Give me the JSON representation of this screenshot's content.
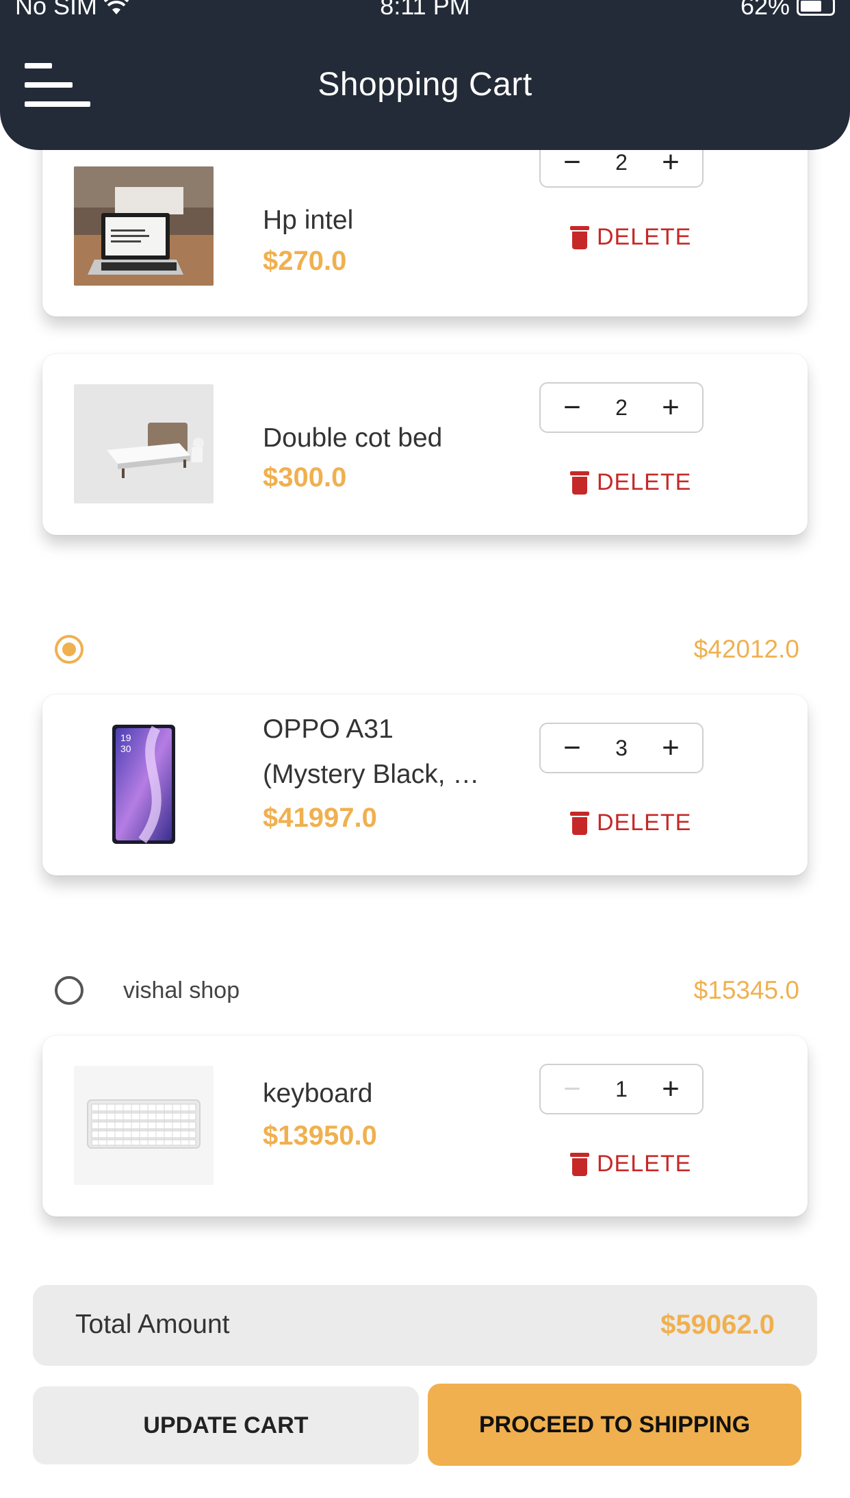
{
  "status_bar": {
    "carrier": "No SIM",
    "time": "8:11 PM",
    "battery": "62%"
  },
  "header": {
    "title": "Shopping Cart"
  },
  "cart_items": [
    {
      "name": "Hp intel",
      "price": "$270.0",
      "quantity": "2",
      "delete_label": "DELETE"
    },
    {
      "name": "Double cot bed",
      "price": "$300.0",
      "quantity": "2",
      "delete_label": "DELETE"
    },
    {
      "name_line1": "OPPO A31",
      "name_line2": "(Mystery Black, …",
      "price": "$41997.0",
      "quantity": "3",
      "delete_label": "DELETE"
    },
    {
      "name": "keyboard",
      "price": "$13950.0",
      "quantity": "1",
      "delete_label": "DELETE"
    }
  ],
  "shops": [
    {
      "name": "",
      "total": "$42012.0",
      "selected": true
    },
    {
      "name": "vishal shop",
      "total": "$15345.0",
      "selected": false
    }
  ],
  "stepper_glyphs": {
    "minus": "−",
    "plus": "+"
  },
  "phone_screen_time": {
    "hour": "19",
    "minute": "30"
  },
  "footer": {
    "total_label": "Total Amount",
    "total_value": "$59062.0",
    "update_label": "UPDATE CART",
    "proceed_label": "PROCEED TO SHIPPING"
  },
  "colors": {
    "accent": "#f0b04f",
    "header_bg": "#232b38",
    "delete": "#c62828"
  }
}
